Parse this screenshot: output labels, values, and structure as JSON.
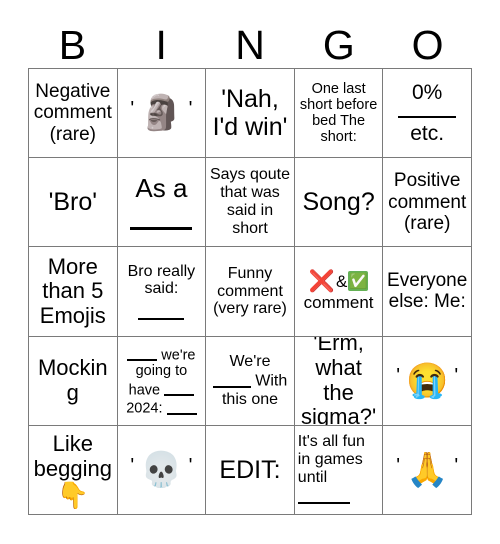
{
  "card": {
    "title_letters": [
      "B",
      "I",
      "N",
      "G",
      "O"
    ],
    "rows": [
      [
        {
          "type": "text",
          "text": "Negative comment (rare)"
        },
        {
          "type": "emoji",
          "emoji": "🗿",
          "emoji_name": "moai",
          "quoted": true
        },
        {
          "type": "text",
          "text": "'Nah, I'd win'"
        },
        {
          "type": "text",
          "text": "One last short before bed The short:"
        },
        {
          "type": "fraction",
          "top": "0%",
          "bottom": "etc."
        }
      ],
      [
        {
          "type": "text",
          "text": "'Bro'"
        },
        {
          "type": "text_blank_below",
          "text": "As a"
        },
        {
          "type": "text",
          "text": "Says qoute that was said in short"
        },
        {
          "type": "text",
          "text": "Song?"
        },
        {
          "type": "text",
          "text": "Positive comment (rare)"
        }
      ],
      [
        {
          "type": "text",
          "text": "More than 5 Emojis"
        },
        {
          "type": "text_blank_below",
          "text": "Bro really said:"
        },
        {
          "type": "text",
          "text": "Funny comment (very rare)"
        },
        {
          "type": "cross_check",
          "cross": "❌",
          "amp": "&",
          "check": "✅",
          "label": "comment"
        },
        {
          "type": "text",
          "text": "Everyone else: Me:"
        }
      ],
      [
        {
          "type": "text",
          "text": "Mocking"
        },
        {
          "type": "fill_blanks_a",
          "part1": "we're going to have",
          "part2": "2024:"
        },
        {
          "type": "fill_blanks_b",
          "part1": "We're",
          "part2": "With",
          "part3": "this one"
        },
        {
          "type": "text",
          "text": "'Erm, what the sigma?'"
        },
        {
          "type": "emoji",
          "emoji": "😭",
          "emoji_name": "loudly-crying-face",
          "quoted": true
        }
      ],
      [
        {
          "type": "text_emoji",
          "text": "Like begging",
          "emoji": "👇",
          "emoji_name": "backhand-index-pointing-down"
        },
        {
          "type": "emoji",
          "emoji": "💀",
          "emoji_name": "skull",
          "quoted": true
        },
        {
          "type": "text",
          "text": "EDIT:"
        },
        {
          "type": "fill_blanks_c",
          "part1": "It's all fun in games until"
        },
        {
          "type": "emoji",
          "emoji": "🙏",
          "emoji_name": "folded-hands",
          "quoted": true
        }
      ]
    ],
    "quote_char": "'"
  }
}
